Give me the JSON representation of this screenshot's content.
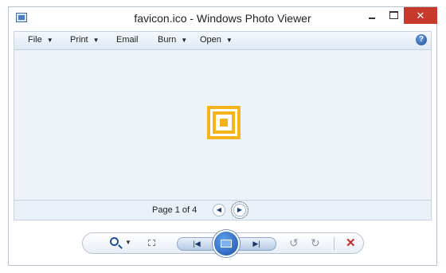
{
  "window": {
    "title": "favicon.ico - Windows Photo Viewer",
    "close_glyph": "✕"
  },
  "menubar": {
    "items": [
      {
        "label": "File",
        "has_dropdown": true
      },
      {
        "label": "Print",
        "has_dropdown": true
      },
      {
        "label": "Email",
        "has_dropdown": false
      },
      {
        "label": "Burn",
        "has_dropdown": true
      },
      {
        "label": "Open",
        "has_dropdown": true
      }
    ],
    "help_glyph": "?"
  },
  "viewer": {
    "image_colors": {
      "frame": "#f6b31c",
      "background": "#ffffff"
    }
  },
  "pagebar": {
    "page_text": "Page 1 of 4",
    "prev_glyph": "◀",
    "next_glyph": "▶"
  },
  "controls": {
    "zoom_caret": "▼",
    "prev_glyph": "|◀",
    "next_glyph": "▶|",
    "rotate_ccw_glyph": "↺",
    "rotate_cw_glyph": "↻",
    "delete_glyph": "✕",
    "accent_color": "#1a4fa8",
    "delete_color": "#c72e2a"
  }
}
